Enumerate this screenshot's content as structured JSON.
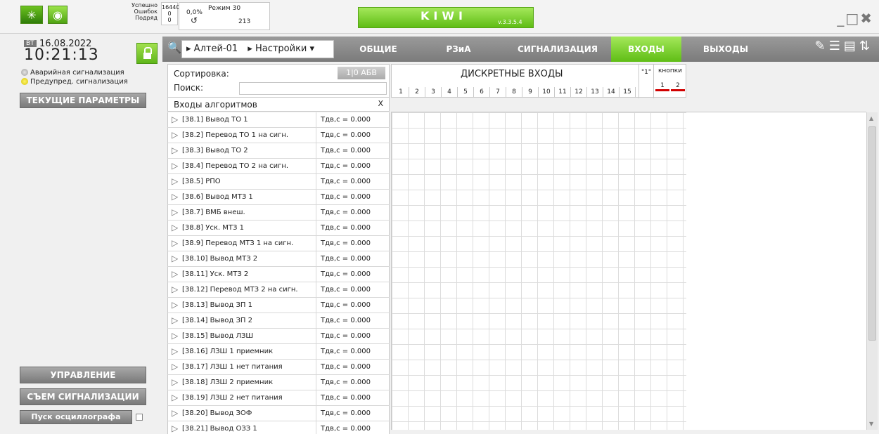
{
  "app": {
    "name": "KIWI",
    "version": "v.3.3.5.4"
  },
  "stats": {
    "labels": [
      "Успешно",
      "Ошибок",
      "Подряд"
    ],
    "values": [
      "16440",
      "0",
      "0"
    ],
    "percent": "0,0%",
    "mode_label": "Режим",
    "mode_value": "30",
    "counter": "213",
    "spinner": "↺"
  },
  "clock": {
    "day": "ВТ",
    "date": "16.08.2022",
    "time": "10:21:13"
  },
  "alarms": {
    "emergency": "Аварийная сигнализация",
    "warning": "Предупред. сигнализация"
  },
  "left_buttons": {
    "params": "ТЕКУЩИЕ ПАРАМЕТРЫ",
    "control": "УПРАВЛЕНИЕ",
    "reset": "СЪЕМ СИГНАЛИЗАЦИИ",
    "osc": "Пуск осциллографа"
  },
  "toolbar": {
    "device": "Алтей-01",
    "menu": "Настройки",
    "tabs": [
      "ОБЩИЕ",
      "РЗиА",
      "СИГНАЛИЗАЦИЯ",
      "ВХОДЫ",
      "ВЫХОДЫ"
    ],
    "active_tab": "ВХОДЫ"
  },
  "filter": {
    "sort_label": "Сортировка:",
    "sort_toggle": "1|0  АБВ",
    "search_label": "Поиск:",
    "search_value": ""
  },
  "list": {
    "title": "Входы алгоритмов",
    "close": "X",
    "items": [
      {
        "name": "[38.1] Вывод ТО 1",
        "value": "Тдв,с =  0.000"
      },
      {
        "name": "[38.2] Перевод ТО 1 на сигн.",
        "value": "Тдв,с =  0.000"
      },
      {
        "name": "[38.3] Вывод ТО 2",
        "value": "Тдв,с =  0.000"
      },
      {
        "name": "[38.4] Перевод ТО 2 на сигн.",
        "value": "Тдв,с =  0.000"
      },
      {
        "name": "[38.5] РПО",
        "value": "Тдв,с =  0.000"
      },
      {
        "name": "[38.6] Вывод МТЗ 1",
        "value": "Тдв,с =  0.000"
      },
      {
        "name": "[38.7] ВМБ внеш.",
        "value": "Тдв,с =  0.000"
      },
      {
        "name": "[38.8] Уск. МТЗ 1",
        "value": "Тдв,с =  0.000"
      },
      {
        "name": "[38.9] Перевод МТЗ 1 на сигн.",
        "value": "Тдв,с =  0.000"
      },
      {
        "name": "[38.10] Вывод МТЗ 2",
        "value": "Тдв,с =  0.000"
      },
      {
        "name": "[38.11] Уск. МТЗ 2",
        "value": "Тдв,с =  0.000"
      },
      {
        "name": "[38.12] Перевод МТЗ 2 на сигн.",
        "value": "Тдв,с =  0.000"
      },
      {
        "name": "[38.13] Вывод ЗП 1",
        "value": "Тдв,с =  0.000"
      },
      {
        "name": "[38.14] Вывод ЗП 2",
        "value": "Тдв,с =  0.000"
      },
      {
        "name": "[38.15] Вывод ЛЗШ",
        "value": "Тдв,с =  0.000"
      },
      {
        "name": "[38.16] ЛЗШ 1 приемник",
        "value": "Тдв,с =  0.000"
      },
      {
        "name": "[38.17] ЛЗШ 1 нет питания",
        "value": "Тдв,с =  0.000"
      },
      {
        "name": "[38.18] ЛЗШ 2 приемник",
        "value": "Тдв,с =  0.000"
      },
      {
        "name": "[38.19] ЛЗШ 2 нет питания",
        "value": "Тдв,с =  0.000"
      },
      {
        "name": "[38.20] Вывод ЗОФ",
        "value": "Тдв,с =  0.000"
      },
      {
        "name": "[38.21] Вывод ОЗЗ 1",
        "value": "Тдв,с =  0.000"
      }
    ]
  },
  "grid": {
    "title": "ДИСКРЕТНЫЕ ВХОДЫ",
    "columns": [
      "1",
      "2",
      "3",
      "4",
      "5",
      "6",
      "7",
      "8",
      "9",
      "10",
      "11",
      "12",
      "13",
      "14",
      "15"
    ],
    "one_label": "\"1\"",
    "buttons_label": "кнопки",
    "buttons": [
      "1",
      "2"
    ]
  }
}
